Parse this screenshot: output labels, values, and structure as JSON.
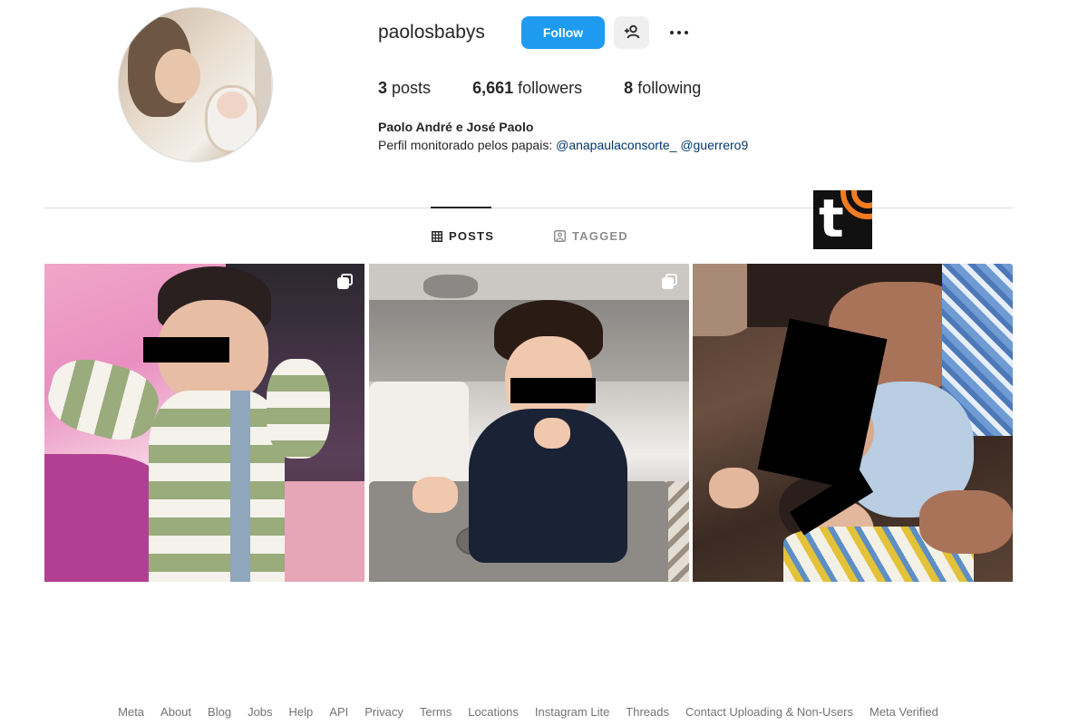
{
  "profile": {
    "username": "paolosbabys",
    "follow_label": "Follow",
    "stats": {
      "posts_count": "3",
      "posts_label": "posts",
      "followers_count": "6,661",
      "followers_label": "followers",
      "following_count": "8",
      "following_label": "following"
    },
    "full_name": "Paolo André e José Paolo",
    "bio_text": "Perfil monitorado pelos papais: ",
    "bio_mentions": [
      "@anapaulaconsorte_",
      "@guerrero9"
    ]
  },
  "tabs": [
    {
      "label": "POSTS",
      "active": true,
      "icon": "grid-icon"
    },
    {
      "label": "TAGGED",
      "active": false,
      "icon": "tagged-icon"
    }
  ],
  "watermark": {
    "letter": "t"
  },
  "posts": [
    {
      "name": "post-1",
      "multi": true
    },
    {
      "name": "post-2",
      "multi": true
    },
    {
      "name": "post-3",
      "multi": false
    }
  ],
  "footer": {
    "links": [
      "Meta",
      "About",
      "Blog",
      "Jobs",
      "Help",
      "API",
      "Privacy",
      "Terms",
      "Locations",
      "Instagram Lite",
      "Threads",
      "Contact Uploading & Non-Users",
      "Meta Verified"
    ]
  },
  "colors": {
    "follow_button": "#1e9bf0",
    "mention": "#00376b",
    "watermark_accent": "#f47c20"
  }
}
